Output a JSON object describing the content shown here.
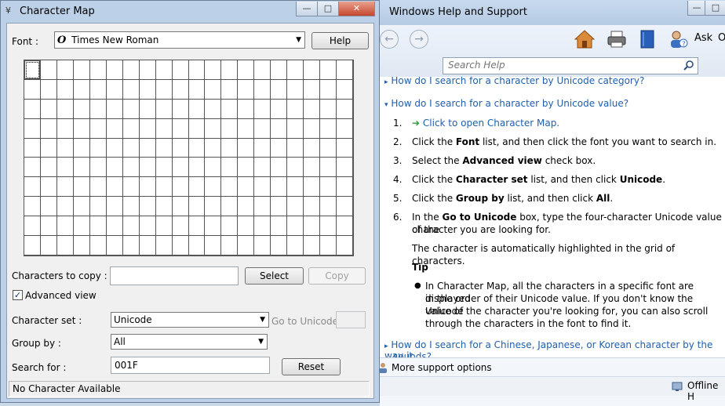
{
  "charmap": {
    "title": "Character Map",
    "minimize": "—",
    "maximize": "□",
    "close": "✕",
    "font_label": "Font :",
    "font_value": "Times New Roman",
    "font_glyph": "O",
    "help_button": "Help",
    "copy_label": "Characters to copy :",
    "copy_value": "",
    "select_button": "Select",
    "copy_button": "Copy",
    "advanced_label": "Advanced view",
    "advanced_checked": true,
    "charset_label": "Character set :",
    "charset_value": "Unicode",
    "goto_label": "Go to Unicode :",
    "groupby_label": "Group by :",
    "groupby_value": "All",
    "search_label": "Search for :",
    "search_value": "001F",
    "reset_button": "Reset",
    "status": "No Character Available"
  },
  "help": {
    "title": "Windows Help and Support",
    "ask_label": "Ask",
    "options_label": "O",
    "search_placeholder": "Search Help",
    "prev_topic": "How do I search for a character by Unicode category?",
    "topic": "How do I search for a character by Unicode value?",
    "steps": [
      {
        "num": "1.",
        "text": "Click to open Character Map."
      },
      {
        "num": "2.",
        "pre": "Click the ",
        "bold": "Font",
        "post": " list, and then click the font you want to search in."
      },
      {
        "num": "3.",
        "pre": "Select the ",
        "bold": "Advanced view",
        "post": " check box."
      },
      {
        "num": "4.",
        "pre": "Click the ",
        "bold": "Character set",
        "post": " list, and then click ",
        "bold2": "Unicode",
        "post2": "."
      },
      {
        "num": "5.",
        "pre": "Click the ",
        "bold": "Group by",
        "post": " list, and then click ",
        "bold2": "All",
        "post2": "."
      },
      {
        "num": "6.",
        "pre": "In the ",
        "bold": "Go to Unicode",
        "post": " box, type the four-character Unicode value of the",
        "line2": "character you are looking for."
      }
    ],
    "highlight_note": "The character is automatically highlighted in the grid of characters.",
    "tip_heading": "Tip",
    "tip_lines": [
      "In Character Map, all the characters in a specific font are displayed",
      "in the order of their Unicode value. If you don't know the Unicode",
      "value of the character you're looking for, you can also scroll",
      "through the characters in the font to find it."
    ],
    "next_topic": "How do I search for a Chinese, Japanese, or Korean character by the way it",
    "next_topic_line2": "sounds?",
    "more_support": "More support options",
    "offline": "Offline H"
  }
}
